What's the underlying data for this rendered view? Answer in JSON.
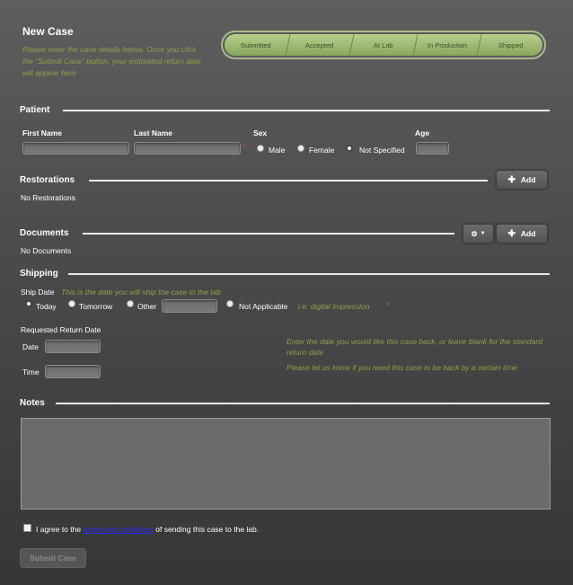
{
  "page": {
    "title": "New Case",
    "intro": "Please enter the case details below. Once you click the \"Submit Case\" button, your estimated return date will appear here"
  },
  "progress": {
    "steps": [
      "Submitted",
      "Accepted",
      "At Lab",
      "In Production",
      "Shipped"
    ]
  },
  "patient": {
    "heading": "Patient",
    "first_name_label": "First Name",
    "last_name_label": "Last Name",
    "sex_label": "Sex",
    "age_label": "Age",
    "required_mark": "*",
    "sex_options": [
      "Male",
      "Female",
      "Not Specified"
    ],
    "sex_selected": "Not Specified"
  },
  "restorations": {
    "heading": "Restorations",
    "add_label": "Add",
    "empty_text": "No Restorations"
  },
  "documents": {
    "heading": "Documents",
    "add_label": "Add",
    "empty_text": "No Documents"
  },
  "shipping": {
    "heading": "Shipping",
    "ship_date_label": "Ship Date",
    "ship_date_hint": "This is the date you will ship the case to the lab",
    "options": [
      "Today",
      "Tomorrow",
      "Other",
      "Not Applicable"
    ],
    "selected": "Today",
    "not_applicable_hint": "i.e. digital impression",
    "required_mark": "*",
    "requested_return_label": "Requested Return Date",
    "date_label": "Date",
    "time_label": "Time",
    "date_hint": "Enter the date you would like this case back, or leave blank for the standard return date",
    "time_hint": "Please let us know if you need this case to be back by a certain time"
  },
  "notes": {
    "heading": "Notes"
  },
  "agreement": {
    "prefix": "I agree to the",
    "link_text": "terms and conditions",
    "suffix": "of sending this case to the lab."
  },
  "submit_label": "Submit Case"
}
